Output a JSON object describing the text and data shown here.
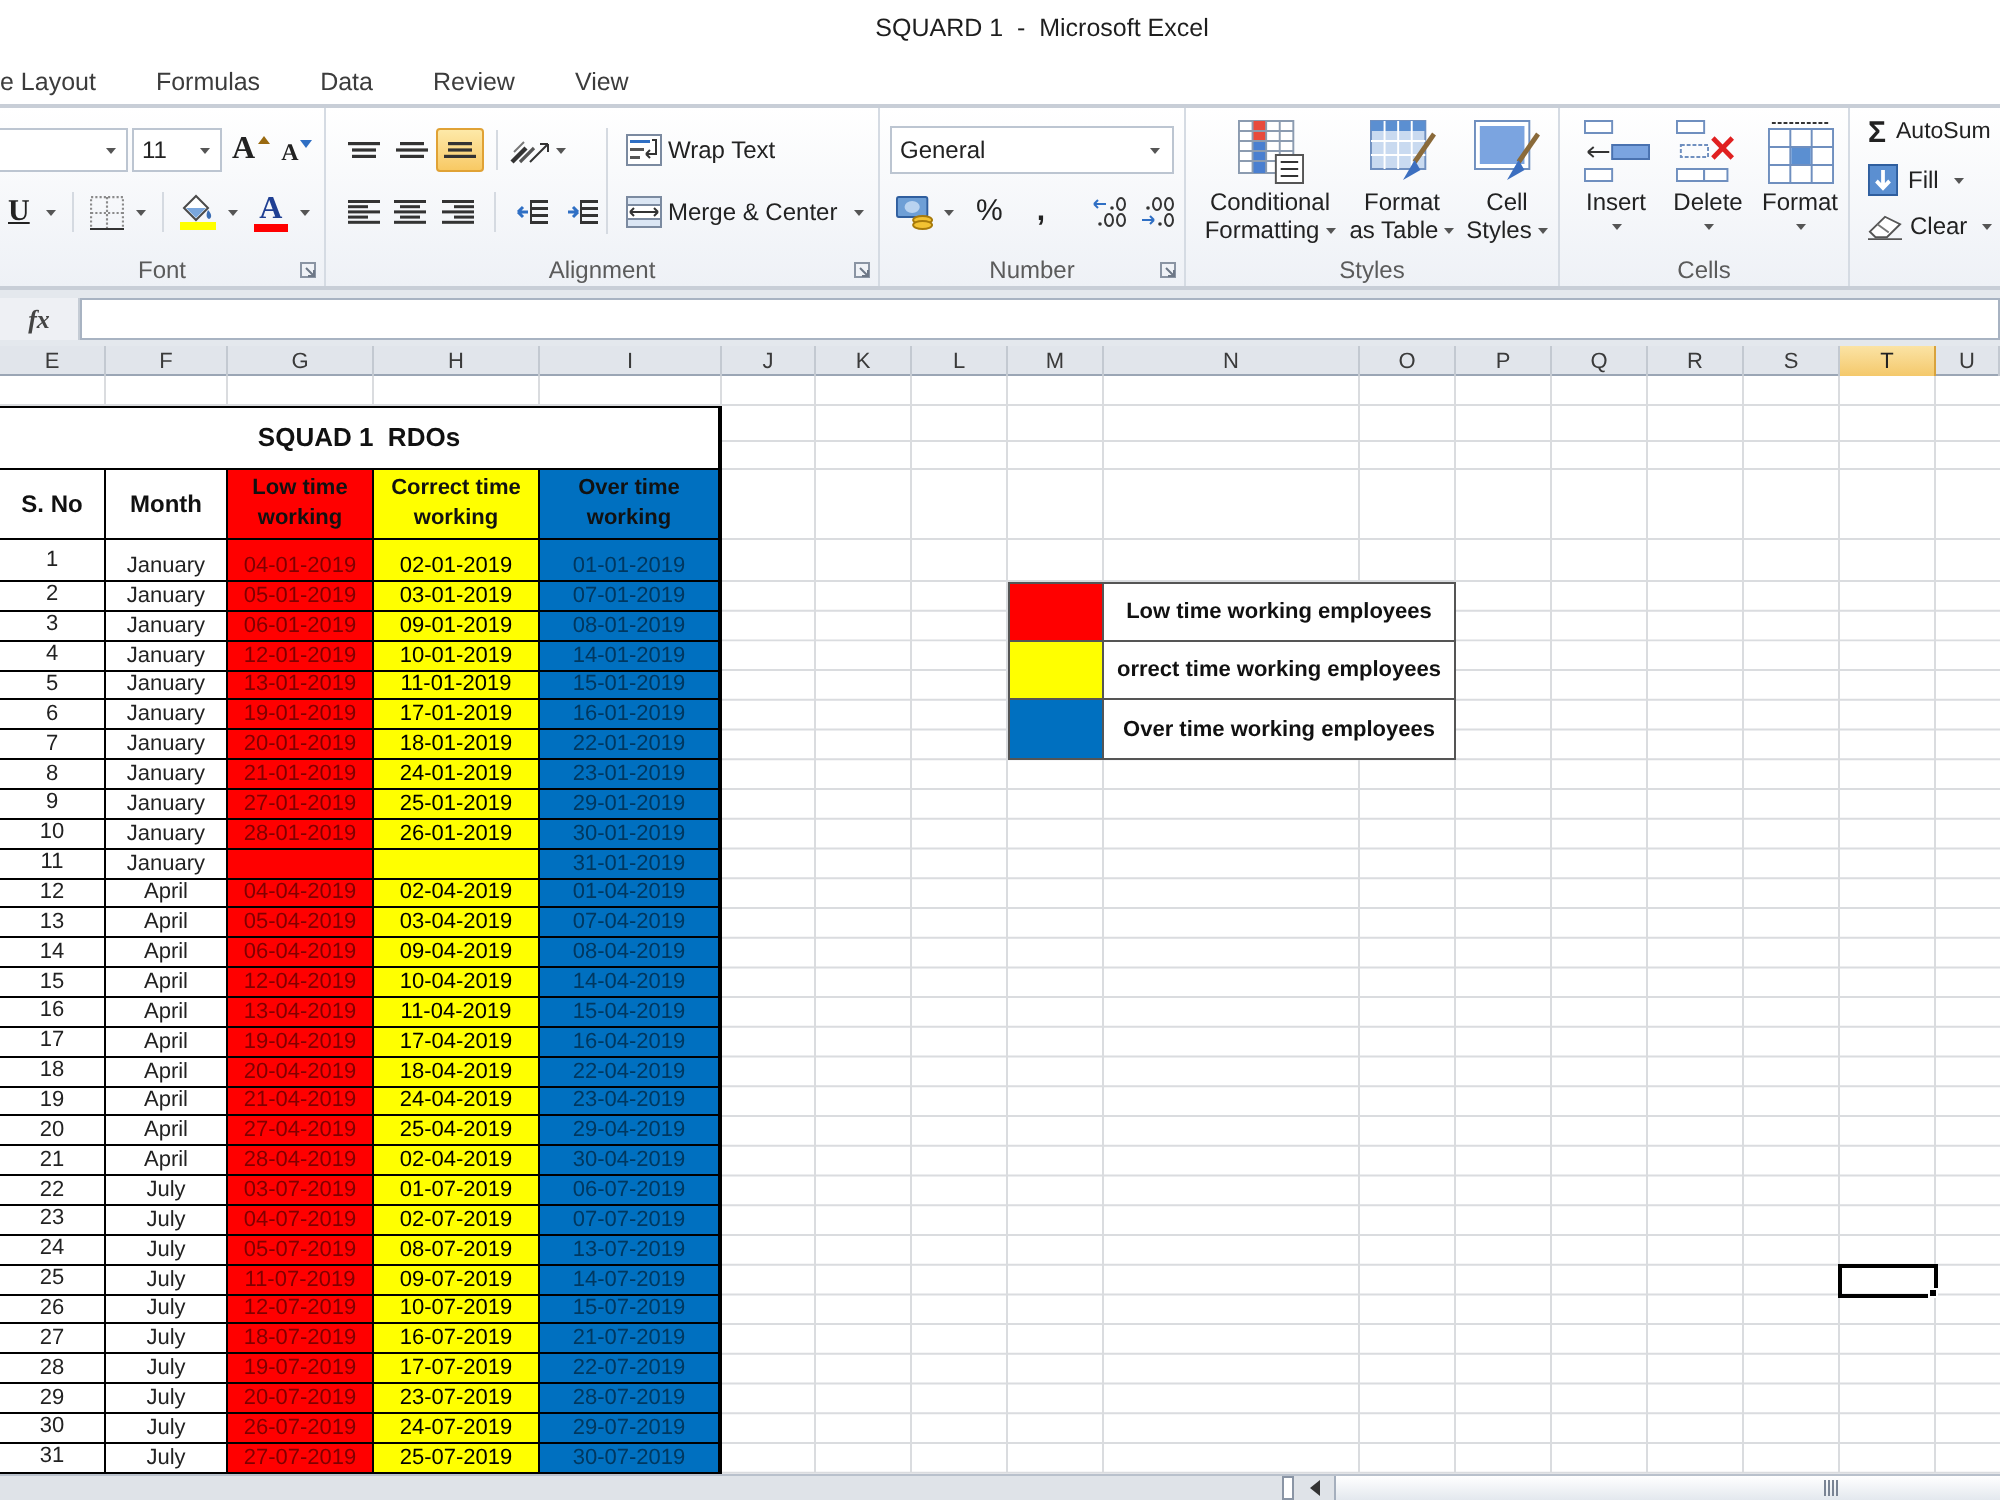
{
  "window": {
    "title": "SQUARD 1  -  Microsoft Excel"
  },
  "tabs": [
    {
      "label": "e Layout",
      "selected": false
    },
    {
      "label": "Formulas",
      "selected": false
    },
    {
      "label": "Data",
      "selected": false
    },
    {
      "label": "Review",
      "selected": false
    },
    {
      "label": "View",
      "selected": false
    }
  ],
  "ribbon": {
    "font": {
      "label": "Font",
      "launcher": true,
      "size": "11",
      "grow_glyph": "A",
      "shrink_glyph": "A",
      "underline_glyph": "U",
      "font_color_glyph": "A"
    },
    "alignment": {
      "label": "Alignment",
      "launcher": true,
      "vertical": [
        {
          "kind": "top",
          "selected": false
        },
        {
          "kind": "middle",
          "selected": false
        },
        {
          "kind": "bottom",
          "selected": true
        }
      ],
      "horizontal": [
        {
          "kind": "left",
          "selected": false
        },
        {
          "kind": "center",
          "selected": false
        },
        {
          "kind": "right",
          "selected": false
        }
      ],
      "wrap_text": "Wrap Text",
      "merge_center": "Merge & Center"
    },
    "number": {
      "label": "Number",
      "launcher": true,
      "format": "General",
      "percent_glyph": "%",
      "comma_glyph": ","
    },
    "styles": {
      "label": "Styles",
      "buttons": [
        {
          "kind": "conditional",
          "lines": [
            "Conditional",
            "Formatting"
          ]
        },
        {
          "kind": "table",
          "lines": [
            "Format",
            "as Table"
          ]
        },
        {
          "kind": "cell",
          "lines": [
            "Cell",
            "Styles"
          ]
        }
      ]
    },
    "cells": {
      "label": "Cells",
      "buttons": [
        {
          "kind": "insert",
          "label": "Insert"
        },
        {
          "kind": "delete",
          "label": "Delete"
        },
        {
          "kind": "format",
          "label": "Format"
        }
      ]
    },
    "editing": {
      "autosum_glyph": "Σ",
      "autosum": "AutoSum",
      "fill": "Fill",
      "clear": "Clear"
    }
  },
  "formula_bar": {
    "function_glyph": "fx"
  },
  "column_headers": [
    {
      "label": "E",
      "selected": false
    },
    {
      "label": "F",
      "selected": false
    },
    {
      "label": "G",
      "selected": false
    },
    {
      "label": "H",
      "selected": false
    },
    {
      "label": "I",
      "selected": false
    },
    {
      "label": "J",
      "selected": false
    },
    {
      "label": "K",
      "selected": false
    },
    {
      "label": "L",
      "selected": false
    },
    {
      "label": "M",
      "selected": false
    },
    {
      "label": "N",
      "selected": false
    },
    {
      "label": "O",
      "selected": false
    },
    {
      "label": "P",
      "selected": false
    },
    {
      "label": "Q",
      "selected": false
    },
    {
      "label": "R",
      "selected": false
    },
    {
      "label": "S",
      "selected": false
    },
    {
      "label": "T",
      "selected": true
    },
    {
      "label": "U",
      "selected": false
    }
  ],
  "table": {
    "title": "SQUAD 1  RDOs",
    "columns": [
      {
        "label": "S. No"
      },
      {
        "label": "Month"
      },
      {
        "label": "Low time working",
        "color": "#ff0000"
      },
      {
        "label": "Correct time working",
        "color": "#ffff00"
      },
      {
        "label": "Over time working",
        "color": "#0070c0"
      }
    ],
    "rows": [
      {
        "s_no": "1",
        "month": "January",
        "low_time": "04-01-2019",
        "correct_time": "02-01-2019",
        "over_time": "01-01-2019"
      },
      {
        "s_no": "2",
        "month": "January",
        "low_time": "05-01-2019",
        "correct_time": "03-01-2019",
        "over_time": "07-01-2019"
      },
      {
        "s_no": "3",
        "month": "January",
        "low_time": "06-01-2019",
        "correct_time": "09-01-2019",
        "over_time": "08-01-2019"
      },
      {
        "s_no": "4",
        "month": "January",
        "low_time": "12-01-2019",
        "correct_time": "10-01-2019",
        "over_time": "14-01-2019"
      },
      {
        "s_no": "5",
        "month": "January",
        "low_time": "13-01-2019",
        "correct_time": "11-01-2019",
        "over_time": "15-01-2019"
      },
      {
        "s_no": "6",
        "month": "January",
        "low_time": "19-01-2019",
        "correct_time": "17-01-2019",
        "over_time": "16-01-2019"
      },
      {
        "s_no": "7",
        "month": "January",
        "low_time": "20-01-2019",
        "correct_time": "18-01-2019",
        "over_time": "22-01-2019"
      },
      {
        "s_no": "8",
        "month": "January",
        "low_time": "21-01-2019",
        "correct_time": "24-01-2019",
        "over_time": "23-01-2019"
      },
      {
        "s_no": "9",
        "month": "January",
        "low_time": "27-01-2019",
        "correct_time": "25-01-2019",
        "over_time": "29-01-2019"
      },
      {
        "s_no": "10",
        "month": "January",
        "low_time": "28-01-2019",
        "correct_time": "26-01-2019",
        "over_time": "30-01-2019"
      },
      {
        "s_no": "11",
        "month": "January",
        "over_time": "31-01-2019"
      },
      {
        "s_no": "12",
        "month": "April",
        "low_time": "04-04-2019",
        "correct_time": "02-04-2019",
        "over_time": "01-04-2019"
      },
      {
        "s_no": "13",
        "month": "April",
        "low_time": "05-04-2019",
        "correct_time": "03-04-2019",
        "over_time": "07-04-2019"
      },
      {
        "s_no": "14",
        "month": "April",
        "low_time": "06-04-2019",
        "correct_time": "09-04-2019",
        "over_time": "08-04-2019"
      },
      {
        "s_no": "15",
        "month": "April",
        "low_time": "12-04-2019",
        "correct_time": "10-04-2019",
        "over_time": "14-04-2019"
      },
      {
        "s_no": "16",
        "month": "April",
        "low_time": "13-04-2019",
        "correct_time": "11-04-2019",
        "over_time": "15-04-2019"
      },
      {
        "s_no": "17",
        "month": "April",
        "low_time": "19-04-2019",
        "correct_time": "17-04-2019",
        "over_time": "16-04-2019"
      },
      {
        "s_no": "18",
        "month": "April",
        "low_time": "20-04-2019",
        "correct_time": "18-04-2019",
        "over_time": "22-04-2019"
      },
      {
        "s_no": "19",
        "month": "April",
        "low_time": "21-04-2019",
        "correct_time": "24-04-2019",
        "over_time": "23-04-2019"
      },
      {
        "s_no": "20",
        "month": "April",
        "low_time": "27-04-2019",
        "correct_time": "25-04-2019",
        "over_time": "29-04-2019"
      },
      {
        "s_no": "21",
        "month": "April",
        "low_time": "28-04-2019",
        "correct_time": "02-04-2019",
        "over_time": "30-04-2019"
      },
      {
        "s_no": "22",
        "month": "July",
        "low_time": "03-07-2019",
        "correct_time": "01-07-2019",
        "over_time": "06-07-2019"
      },
      {
        "s_no": "23",
        "month": "July",
        "low_time": "04-07-2019",
        "correct_time": "02-07-2019",
        "over_time": "07-07-2019"
      },
      {
        "s_no": "24",
        "month": "July",
        "low_time": "05-07-2019",
        "correct_time": "08-07-2019",
        "over_time": "13-07-2019"
      },
      {
        "s_no": "25",
        "month": "July",
        "low_time": "11-07-2019",
        "correct_time": "09-07-2019",
        "over_time": "14-07-2019"
      },
      {
        "s_no": "26",
        "month": "July",
        "low_time": "12-07-2019",
        "correct_time": "10-07-2019",
        "over_time": "15-07-2019"
      },
      {
        "s_no": "27",
        "month": "July",
        "low_time": "18-07-2019",
        "correct_time": "16-07-2019",
        "over_time": "21-07-2019"
      },
      {
        "s_no": "28",
        "month": "July",
        "low_time": "19-07-2019",
        "correct_time": "17-07-2019",
        "over_time": "22-07-2019"
      },
      {
        "s_no": "29",
        "month": "July",
        "low_time": "20-07-2019",
        "correct_time": "23-07-2019",
        "over_time": "28-07-2019"
      },
      {
        "s_no": "30",
        "month": "July",
        "low_time": "26-07-2019",
        "correct_time": "24-07-2019",
        "over_time": "29-07-2019"
      },
      {
        "s_no": "31",
        "month": "July",
        "low_time": "27-07-2019",
        "correct_time": "25-07-2019",
        "over_time": "30-07-2019"
      }
    ]
  },
  "legend": [
    {
      "label": "Low time working employees",
      "color": "#ff0000"
    },
    {
      "label": "orrect time working employees",
      "color": "#ffff00"
    },
    {
      "label": "Over time working employees",
      "color": "#0070c0"
    }
  ]
}
